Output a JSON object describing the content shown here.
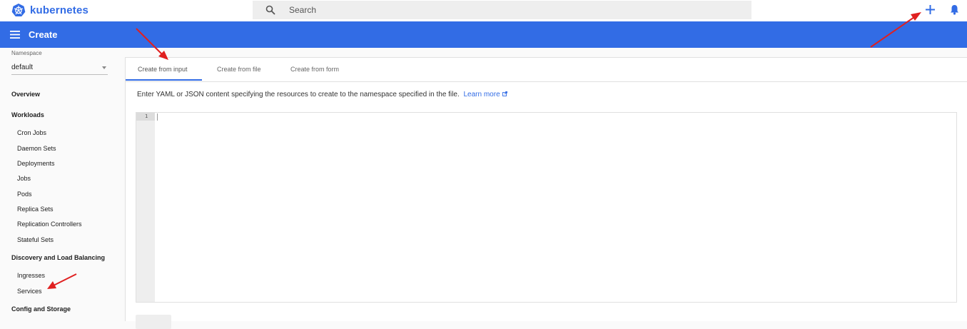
{
  "header": {
    "app_name": "kubernetes",
    "search_placeholder": "Search",
    "icons": [
      "kubernetes-logo-icon",
      "search-icon",
      "add-icon",
      "notifications-icon"
    ],
    "page_title": "Create"
  },
  "sidebar": {
    "namespace_label": "Namespace",
    "namespace_value": "default",
    "overview": "Overview",
    "workloads": "Workloads",
    "workload_items": [
      "Cron Jobs",
      "Daemon Sets",
      "Deployments",
      "Jobs",
      "Pods",
      "Replica Sets",
      "Replication Controllers",
      "Stateful Sets"
    ],
    "discovery": "Discovery and Load Balancing",
    "discovery_items": [
      "Ingresses",
      "Services"
    ],
    "config": "Config and Storage"
  },
  "main": {
    "tabs": [
      "Create from input",
      "Create from file",
      "Create from form"
    ],
    "active_tab": "Create from input",
    "description": "Enter YAML or JSON content specifying the resources to create to the namespace specified in the file.",
    "learn_more": "Learn more",
    "editor": {
      "line_numbers": [
        "1"
      ],
      "content": ""
    }
  },
  "colors": {
    "brand": "#326ce5",
    "annotation_arrow": "#e02020"
  }
}
